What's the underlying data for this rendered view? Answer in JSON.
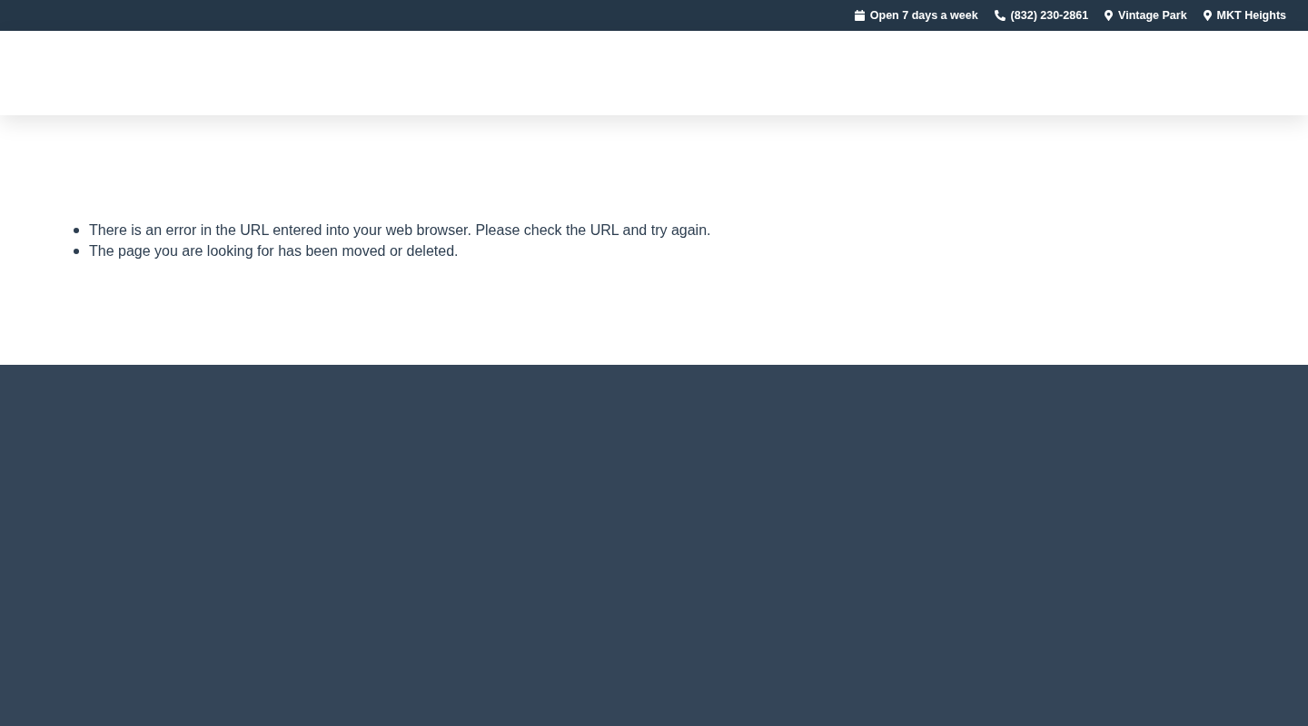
{
  "top_bar": {
    "items": [
      {
        "kind": "hours",
        "label": "Open 7 days a week"
      },
      {
        "kind": "phone",
        "label": "(832) 230-2861"
      },
      {
        "kind": "location",
        "label": "Vintage Park"
      },
      {
        "kind": "location",
        "label": "MKT Heights"
      }
    ]
  },
  "error_reasons": [
    "There is an error in the URL entered into your web browser. Please check the URL and try again.",
    "The page you are looking for has been moved or deleted."
  ]
}
